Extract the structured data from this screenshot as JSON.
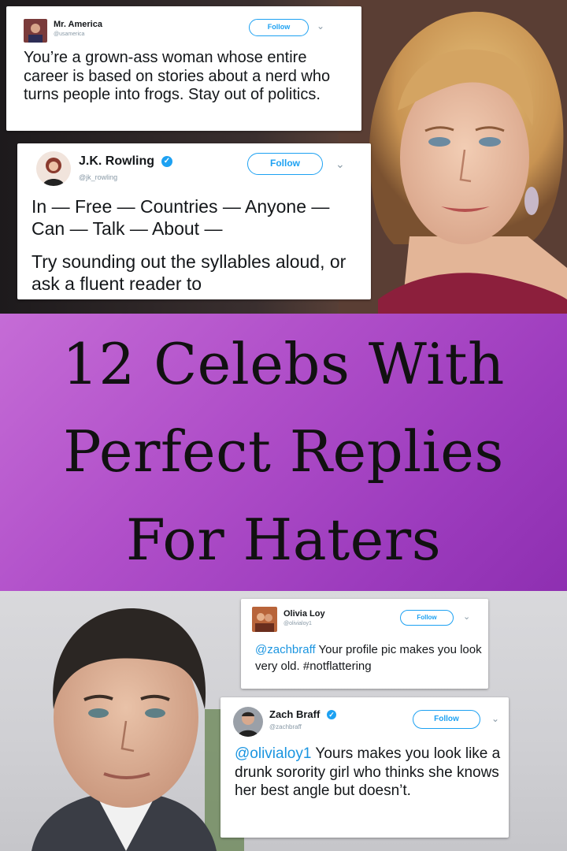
{
  "banner": {
    "line1": "12 Celebs With",
    "line2": "Perfect Replies",
    "line3": "For Haters"
  },
  "tweets": [
    {
      "name": "Mr. America",
      "handle": "@​usamerica",
      "follow_label": "Follow",
      "text": "You’re a grown-ass woman whose entire career is based on stories about a nerd who turns people into frogs. Stay out of politics."
    },
    {
      "name": "J.K. Rowling",
      "handle": "@jk_rowling",
      "follow_label": "Follow",
      "verified": true,
      "text": "In — Free — Countries — Anyone — Can — Talk — About —",
      "text2": "Try sounding out the syllables aloud, or ask a fluent reader to"
    },
    {
      "name": "Olivia Loy",
      "handle": "@olivialoy1",
      "follow_label": "Follow",
      "mention": "@zachbraff",
      "text": " Your profile pic makes you look very old. #notflattering"
    },
    {
      "name": "Zach Braff",
      "handle": "@zachbraff",
      "follow_label": "Follow",
      "verified": true,
      "mention": "@olivialoy1",
      "text": " Yours makes you look like a drunk sorority girl who thinks she knows her best angle but doesn’t."
    }
  ],
  "colors": {
    "banner_purple": "#b04fc9",
    "twitter_blue": "#1da1f2",
    "mention_blue": "#1b95e0"
  },
  "icons": {
    "follow_caret": "chevron-down-icon",
    "verified": "verified-badge-icon"
  }
}
